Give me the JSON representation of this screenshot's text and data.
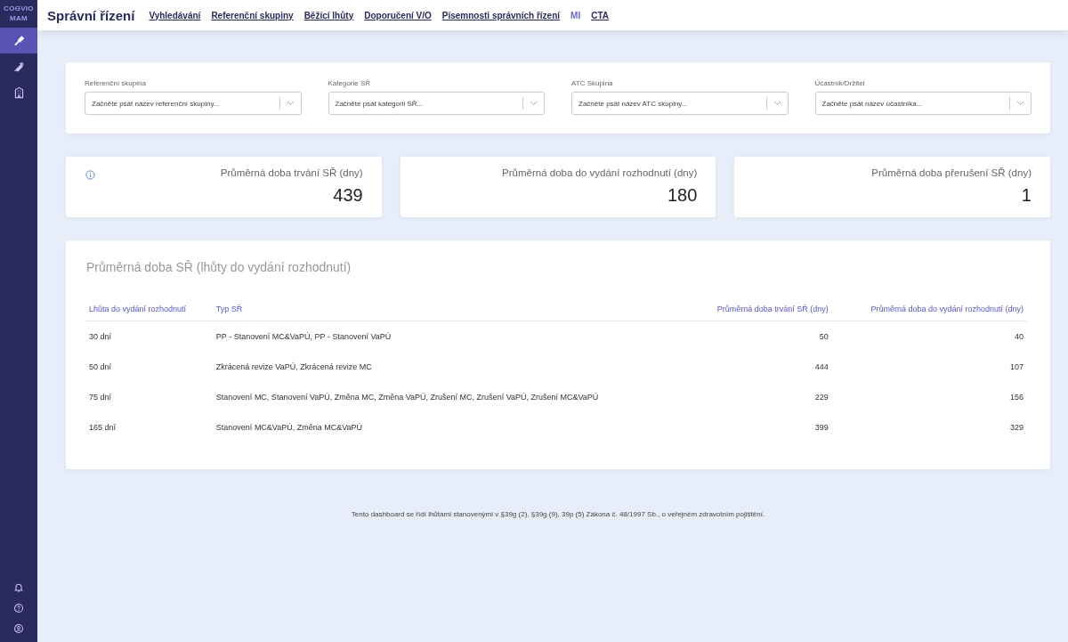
{
  "sidebar": {
    "logo": [
      "COGVIO",
      "MAM"
    ],
    "items": [
      {
        "selected": true
      },
      {
        "selected": false
      },
      {
        "selected": false
      }
    ]
  },
  "topbar": {
    "title": "Správní řízení",
    "nav": [
      {
        "label": "Vyhledávání",
        "selected": false
      },
      {
        "label": "Referenční skupiny",
        "selected": false
      },
      {
        "label": "Běžící lhůty",
        "selected": false
      },
      {
        "label": "Doporučení V/O",
        "selected": false
      },
      {
        "label": "Písemnosti správních řízení",
        "selected": false
      },
      {
        "label": "MI",
        "selected": true
      },
      {
        "label": "CTA",
        "selected": false
      }
    ]
  },
  "filters": [
    {
      "label": "Referenční skupina",
      "placeholder": "Začněte psát název referenční skupiny..."
    },
    {
      "label": "Kategorie SŘ",
      "placeholder": "Začněte psát kategorii SŘ..."
    },
    {
      "label": "ATC Skupina",
      "placeholder": "Začněte psát název ATC skupiny..."
    },
    {
      "label": "Účastník/Držitel",
      "placeholder": "Začněte psát název účastníka..."
    }
  ],
  "stats": [
    {
      "label": "Průměrná doba trvání SŘ (dny)",
      "value": "439",
      "info": true
    },
    {
      "label": "Průměrná doba do vydání rozhodnutí (dny)",
      "value": "180",
      "info": false
    },
    {
      "label": "Průměrná doba přerušení SŘ (dny)",
      "value": "1",
      "info": false
    }
  ],
  "table": {
    "title": "Průměrná doba SŘ (lhůty do vydání rozhodnutí)",
    "columns": [
      "Lhůta do vydání rozhodnutí",
      "Typ SŘ",
      "Průměrná doba trvání SŘ (dny)",
      "Průměrná doba do vydání rozhodnutí (dny)"
    ],
    "rows": [
      [
        "30 dní",
        "PP - Stanovení MC&VaPÚ, PP - Stanovení VaPÚ",
        "50",
        "40"
      ],
      [
        "50 dní",
        "Zkrácená revize VaPÚ, Zkrácená revize MC",
        "444",
        "107"
      ],
      [
        "75 dní",
        "Stanovení MC, Stanovení VaPÚ, Změna MC, Změna VaPÚ, Zrušení MC, Zrušení VaPÚ, Zrušení MC&VaPÚ",
        "229",
        "156"
      ],
      [
        "165 dní",
        "Stanovení MC&VaPÚ, Změna MC&VaPÚ",
        "399",
        "329"
      ]
    ]
  },
  "footer": "Tento dashboard se řídí lhůtami stanovenými v §39g (2), §39g (9), 39p (5) Zákona č. 48/1997 Sb., o veřejném zdravotním pojištění."
}
